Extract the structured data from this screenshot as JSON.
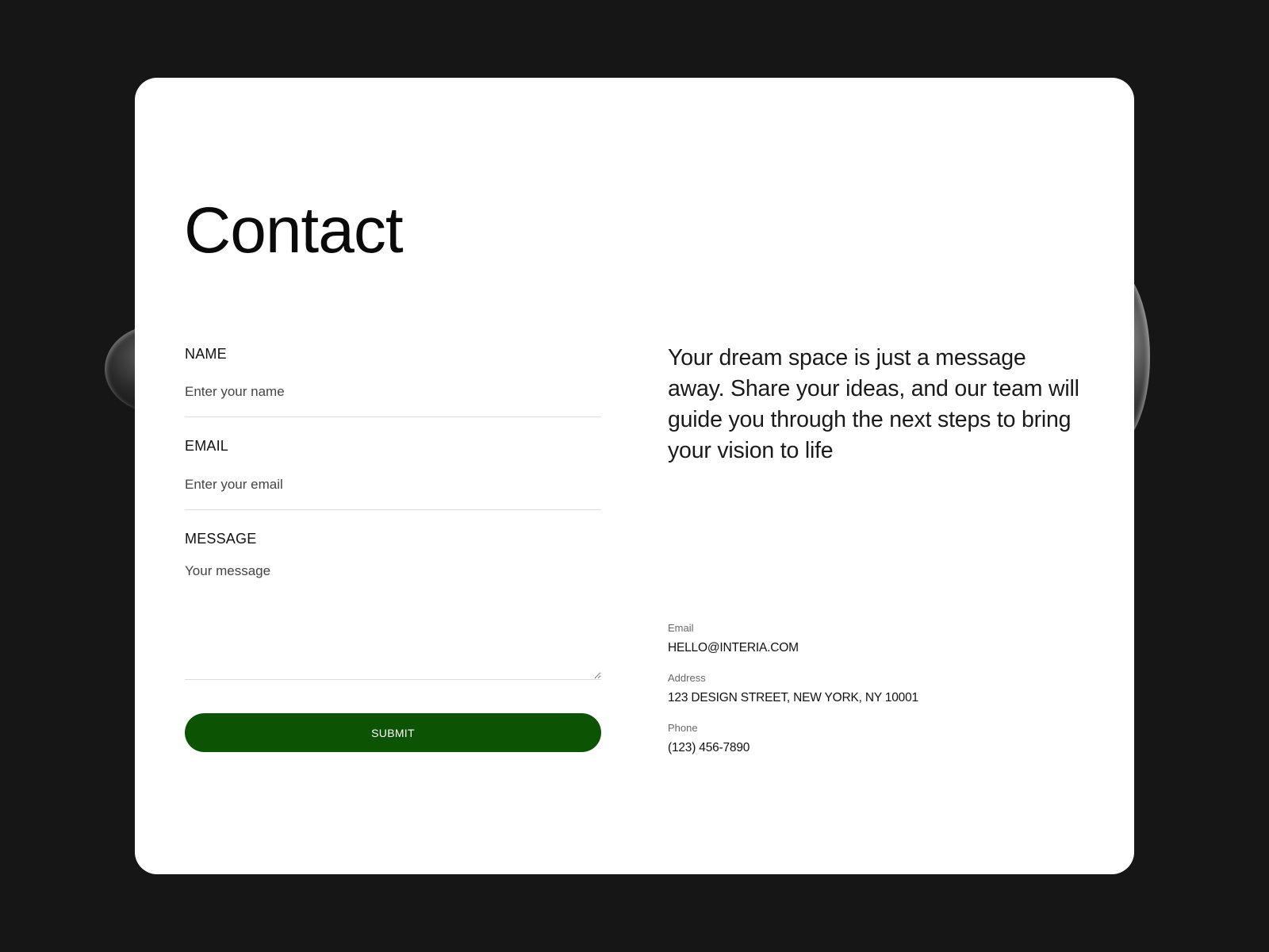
{
  "page": {
    "title": "Contact"
  },
  "form": {
    "name": {
      "label": "NAME",
      "placeholder": "Enter your name",
      "value": ""
    },
    "email": {
      "label": "EMAIL",
      "placeholder": "Enter your email",
      "value": ""
    },
    "message": {
      "label": "MESSAGE",
      "placeholder": "Your message",
      "value": ""
    },
    "submit_label": "SUBMIT"
  },
  "intro": {
    "text": "Your dream space is just a message away. Share your ideas, and our team will guide you through the next steps to bring your vision to life"
  },
  "contact_info": {
    "email": {
      "label": "Email",
      "value": "HELLO@INTERIA.COM"
    },
    "address": {
      "label": "Address",
      "value": "123 DESIGN STREET, NEW YORK, NY 10001"
    },
    "phone": {
      "label": "Phone",
      "value": "(123) 456-7890"
    }
  },
  "colors": {
    "background": "#161616",
    "card": "#ffffff",
    "accent": "#0c5304"
  }
}
